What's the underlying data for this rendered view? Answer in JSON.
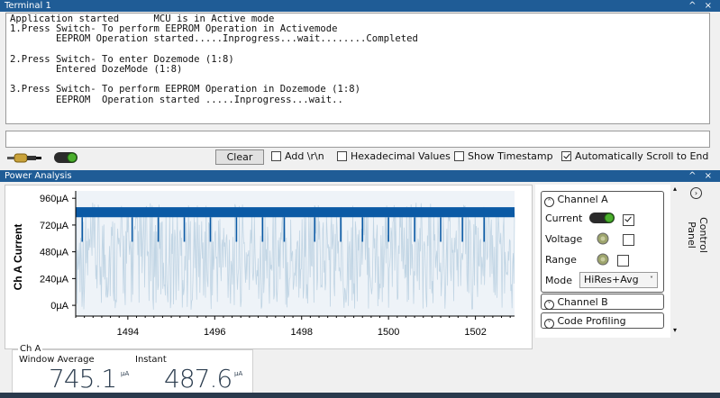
{
  "terminal": {
    "title": "Terminal 1",
    "window_controls": "^ ×",
    "lines": [
      "Application started      MCU is in Active mode",
      "1.Press Switch- To perform EEPROM Operation in Activemode",
      "        EEPROM Operation started.....Inprogress...wait........Completed",
      "",
      "2.Press Switch- To enter Dozemode (1:8)",
      "        Entered DozeMode (1:8)",
      "",
      "3.Press Switch- To perform EEPROM Operation in Dozemode (1:8)",
      "        EEPROM  Operation started .....Inprogress...wait.."
    ],
    "input_value": "",
    "clear_label": "Clear",
    "options": [
      {
        "label": "Add \\r\\n",
        "checked": false
      },
      {
        "label": "Hexadecimal Values",
        "checked": false
      },
      {
        "label": "Show Timestamp",
        "checked": false
      },
      {
        "label": "Automatically Scroll to End",
        "checked": true
      }
    ],
    "connect_icon": "plug-cable-icon",
    "status_icon": "toggle-green-icon"
  },
  "power": {
    "title": "Power Analysis",
    "window_controls": "^ ×",
    "control_panel_label": "Control Panel",
    "channel_a": {
      "header": "Channel A",
      "current_label": "Current",
      "current_checked": true,
      "voltage_label": "Voltage",
      "voltage_checked": false,
      "range_label": "Range",
      "range_checked": false,
      "mode_label": "Mode",
      "mode_value": "HiRes+Avg"
    },
    "channel_b": {
      "header": "Channel B"
    },
    "code_profiling": {
      "header": "Code Profiling"
    },
    "readout": {
      "group_label": "Ch A",
      "window_average_label": "Window Average",
      "window_average_value": "745.1",
      "instant_label": "Instant",
      "instant_value": "487.6",
      "unit": "µA"
    }
  },
  "chart_data": {
    "type": "line",
    "ylabel": "Ch A Current",
    "ytick_labels": [
      "960µA",
      "720µA",
      "480µA",
      "240µA",
      "0µA"
    ],
    "ytick_values": [
      960,
      720,
      480,
      240,
      0
    ],
    "xtick_labels": [
      "1494",
      "1496",
      "1498",
      "1500",
      "1502"
    ],
    "xtick_values": [
      1494,
      1496,
      1498,
      1500,
      1502
    ],
    "xlim": [
      1492.8,
      1502.9
    ],
    "ylim": [
      -80,
      1010
    ],
    "series": [
      {
        "color": "#0b5aa5",
        "band": [
          790,
          880
        ],
        "dip_to": 570,
        "dip_x": [
          1492.95,
          1494.1,
          1494.7,
          1495.3,
          1495.9,
          1496.5,
          1497.1,
          1497.6,
          1498.3,
          1498.9,
          1499.4,
          1500.0,
          1500.6,
          1501.2,
          1501.7,
          1502.2
        ]
      },
      {
        "color": "#b9cfe0",
        "band": [
          -40,
          920
        ]
      }
    ]
  }
}
